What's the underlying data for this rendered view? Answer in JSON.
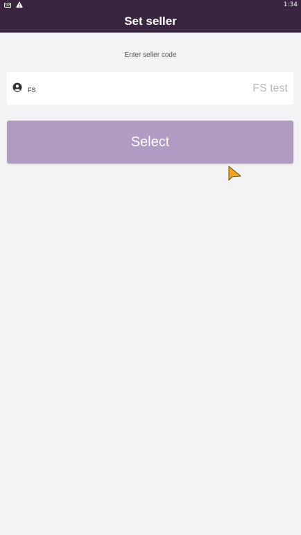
{
  "status_bar": {
    "time": "1:34",
    "icons": [
      "keyboard-icon",
      "warning-icon"
    ]
  },
  "app_bar": {
    "title": "Set seller"
  },
  "form": {
    "prompt": "Enter seller code",
    "seller_code_value": "FS",
    "seller_name": "FS test",
    "field_icon": "user-icon"
  },
  "actions": {
    "select_label": "Select"
  },
  "colors": {
    "app_bar": "#3a2540",
    "background": "#f3f3f6",
    "button": "#b09cc2",
    "cursor": "#f5a623"
  }
}
